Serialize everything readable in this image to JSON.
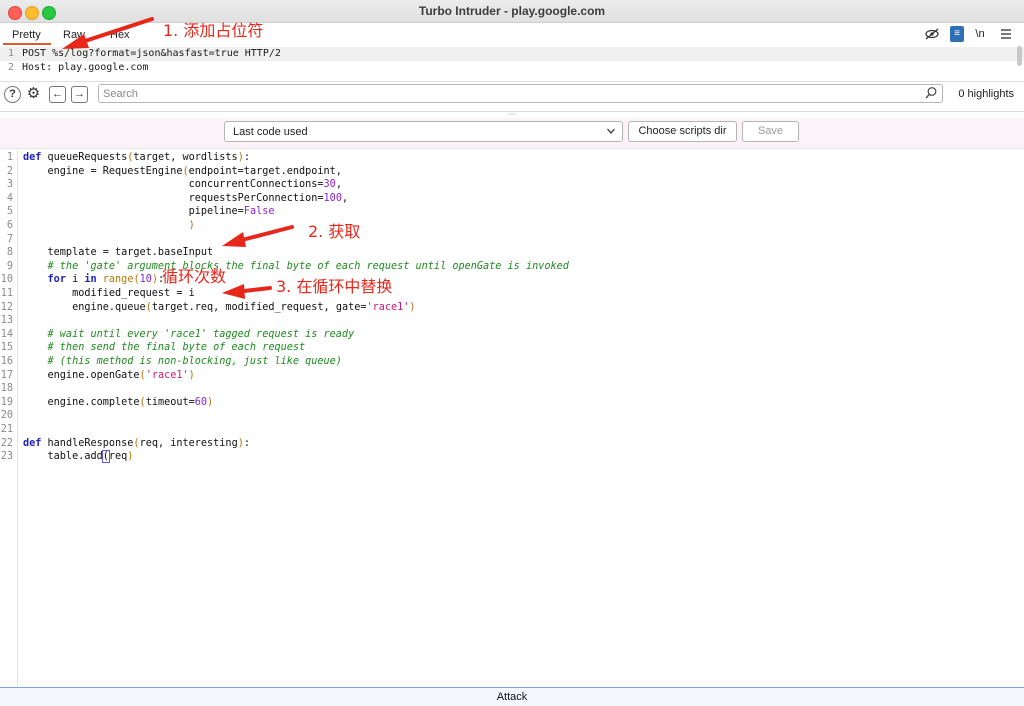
{
  "window": {
    "title": "Turbo Intruder - play.google.com"
  },
  "tabs": [
    {
      "label": "Pretty"
    },
    {
      "label": "Raw"
    },
    {
      "label": "Hex"
    }
  ],
  "top_icons": {
    "wrap": "≡",
    "newline": "\\n"
  },
  "request": {
    "lines": [
      {
        "num": "1",
        "text": "POST %s/log?format=json&hasfast=true HTTP/2"
      },
      {
        "num": "2",
        "text": "Host: play.google.com"
      }
    ]
  },
  "search": {
    "placeholder": "Search",
    "value": "",
    "highlights": "0 highlights"
  },
  "toolbar": {
    "dropdown_value": "Last code used",
    "scripts_button": "Choose scripts dir",
    "save_button": "Save"
  },
  "code": {
    "line_numbers": [
      "1",
      "2",
      "3",
      "4",
      "5",
      "6",
      "7",
      "8",
      "9",
      "10",
      "11",
      "12",
      "13",
      "14",
      "15",
      "16",
      "17",
      "18",
      "19",
      "20",
      "21",
      "22",
      "23"
    ],
    "lines": [
      [
        {
          "t": "def",
          "c": "kw"
        },
        {
          "t": " queueRequests",
          "c": ""
        },
        {
          "t": "(",
          "c": "fn"
        },
        {
          "t": "target, wordlists",
          "c": ""
        },
        {
          "t": ")",
          "c": "fn"
        },
        {
          "t": ":",
          "c": ""
        }
      ],
      [
        {
          "t": "    engine = RequestEngine",
          "c": ""
        },
        {
          "t": "(",
          "c": "fn"
        },
        {
          "t": "endpoint=target.endpoint,",
          "c": ""
        }
      ],
      [
        {
          "t": "                           concurrentConnections=",
          "c": ""
        },
        {
          "t": "30",
          "c": "num"
        },
        {
          "t": ",",
          "c": ""
        }
      ],
      [
        {
          "t": "                           requestsPerConnection=",
          "c": ""
        },
        {
          "t": "100",
          "c": "num"
        },
        {
          "t": ",",
          "c": ""
        }
      ],
      [
        {
          "t": "                           pipeline=",
          "c": ""
        },
        {
          "t": "False",
          "c": "num"
        }
      ],
      [
        {
          "t": "                           ",
          "c": ""
        },
        {
          "t": ")",
          "c": "fn"
        }
      ],
      [
        {
          "t": "",
          "c": ""
        }
      ],
      [
        {
          "t": "    template = target.baseInput",
          "c": ""
        }
      ],
      [
        {
          "t": "    # the 'gate' argument blocks the final byte of each request until openGate is invoked",
          "c": "cmt"
        }
      ],
      [
        {
          "t": "    ",
          "c": ""
        },
        {
          "t": "for",
          "c": "kw"
        },
        {
          "t": " i ",
          "c": ""
        },
        {
          "t": "in",
          "c": "kw"
        },
        {
          "t": " ",
          "c": ""
        },
        {
          "t": "range(",
          "c": "fn"
        },
        {
          "t": "10",
          "c": "num"
        },
        {
          "t": ")",
          "c": "fn"
        },
        {
          "t": ":",
          "c": ""
        }
      ],
      [
        {
          "t": "        modified_request = i",
          "c": ""
        }
      ],
      [
        {
          "t": "        engine.queue",
          "c": ""
        },
        {
          "t": "(",
          "c": "fn"
        },
        {
          "t": "target.req, modified_request, gate=",
          "c": ""
        },
        {
          "t": "'race1'",
          "c": "str"
        },
        {
          "t": ")",
          "c": "fn"
        }
      ],
      [
        {
          "t": "",
          "c": ""
        }
      ],
      [
        {
          "t": "    # wait until every 'race1' tagged request is ready",
          "c": "cmt"
        }
      ],
      [
        {
          "t": "    # then send the final byte of each request",
          "c": "cmt"
        }
      ],
      [
        {
          "t": "    # (this method is non-blocking, just like queue)",
          "c": "cmt"
        }
      ],
      [
        {
          "t": "    engine.openGate",
          "c": ""
        },
        {
          "t": "(",
          "c": "fn"
        },
        {
          "t": "'race1'",
          "c": "str"
        },
        {
          "t": ")",
          "c": "fn"
        }
      ],
      [
        {
          "t": "",
          "c": ""
        }
      ],
      [
        {
          "t": "    engine.complete",
          "c": ""
        },
        {
          "t": "(",
          "c": "fn"
        },
        {
          "t": "timeout=",
          "c": ""
        },
        {
          "t": "60",
          "c": "num"
        },
        {
          "t": ")",
          "c": "fn"
        }
      ],
      [
        {
          "t": "",
          "c": ""
        }
      ],
      [
        {
          "t": "",
          "c": ""
        }
      ],
      [
        {
          "t": "def",
          "c": "kw"
        },
        {
          "t": " handleResponse",
          "c": ""
        },
        {
          "t": "(",
          "c": "fn"
        },
        {
          "t": "req, interesting",
          "c": ""
        },
        {
          "t": ")",
          "c": "fn"
        },
        {
          "t": ":",
          "c": ""
        }
      ],
      [
        {
          "t": "    table.add",
          "c": ""
        },
        {
          "t": "(",
          "c": "paren"
        },
        {
          "t": "req",
          "c": ""
        },
        {
          "t": ")",
          "c": "fn"
        }
      ]
    ]
  },
  "attack_button": "Attack",
  "annotations": {
    "a1": "1. 添加占位符",
    "a2": "2. 获取",
    "a3": "3. 在循环中替换",
    "a4": "循环次数"
  },
  "colors": {
    "annotation": "#e8271b",
    "accent": "#e05a2b",
    "wrap_icon": "#2e6fb8"
  }
}
